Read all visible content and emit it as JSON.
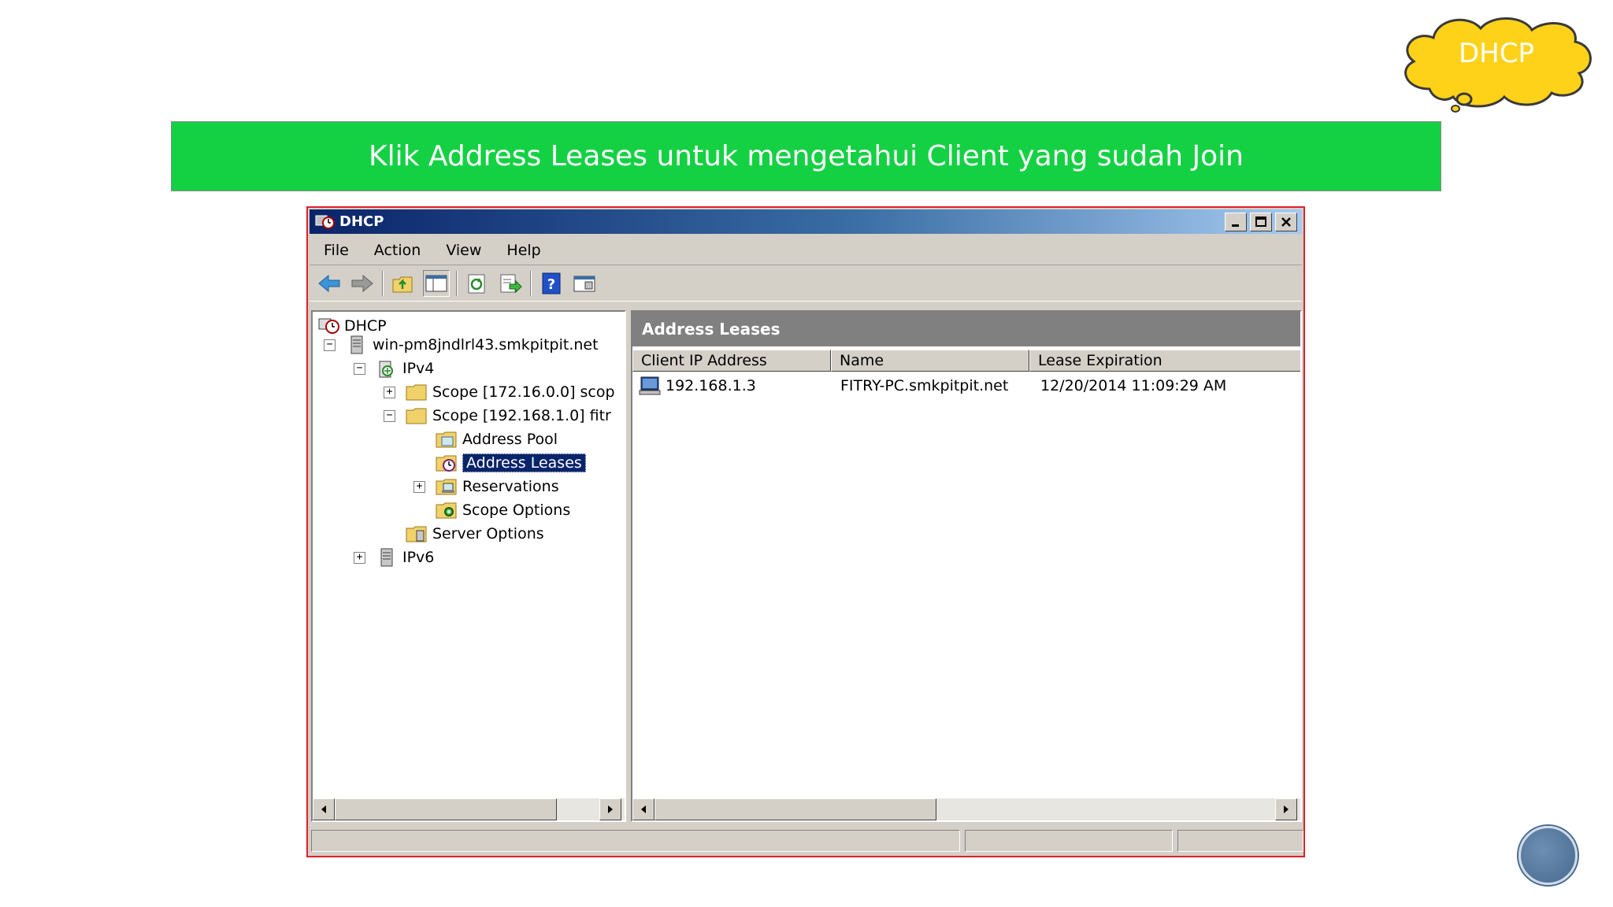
{
  "badge": {
    "label": "DHCP",
    "color": "#ffd21a"
  },
  "banner": {
    "text": "Klik Address Leases untuk mengetahui Client yang sudah Join",
    "color": "#14d143"
  },
  "window": {
    "title": "DHCP",
    "menu": [
      "File",
      "Action",
      "View",
      "Help"
    ],
    "toolbar_icons": [
      "back-arrow-icon",
      "forward-arrow-icon",
      "up-folder-icon",
      "show-hide-tree-icon",
      "refresh-icon",
      "export-list-icon",
      "help-icon",
      "properties-icon"
    ]
  },
  "tree": {
    "root": "DHCP",
    "server": "win-pm8jndlrl43.smkpitpit.net",
    "ipv4": "IPv4",
    "scope1": "Scope [172.16.0.0] scop",
    "scope2": "Scope [192.168.1.0] fitr",
    "address_pool": "Address Pool",
    "address_leases": "Address Leases",
    "reservations": "Reservations",
    "scope_options": "Scope Options",
    "server_options": "Server Options",
    "ipv6": "IPv6"
  },
  "details": {
    "header": "Address Leases",
    "columns": [
      "Client IP Address",
      "Name",
      "Lease Expiration"
    ],
    "rows": [
      {
        "ip": "192.168.1.3",
        "name": "FITRY-PC.smkpitpit.net",
        "expiration": "12/20/2014 11:09:29 AM"
      }
    ]
  }
}
